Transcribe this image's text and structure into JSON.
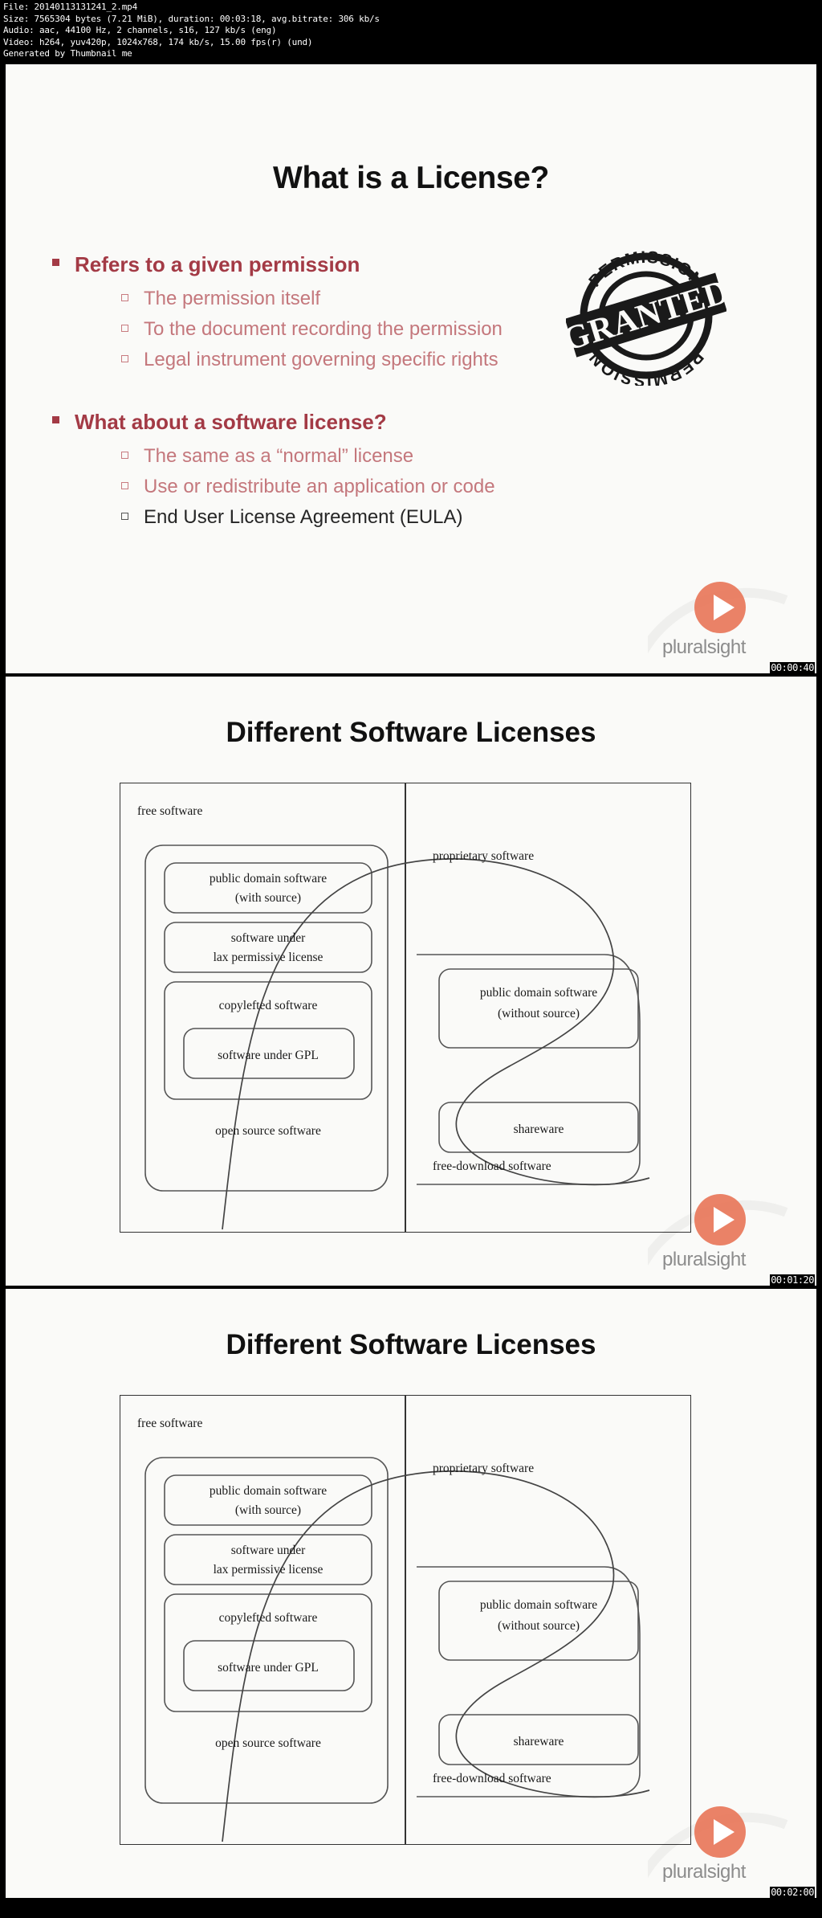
{
  "header": {
    "lines": [
      "File: 20140113131241_2.mp4",
      "Size: 7565304 bytes (7.21 MiB), duration: 00:03:18, avg.bitrate: 306 kb/s",
      "Audio: aac, 44100 Hz, 2 channels, s16, 127 kb/s (eng)",
      "Video: h264, yuv420p, 1024x768, 174 kb/s, 15.00 fps(r) (und)",
      "Generated by Thumbnail me"
    ]
  },
  "brand": {
    "wordmark": "pluralsight",
    "accent_color": "#e8775a"
  },
  "frames": [
    {
      "timestamp": "00:00:40"
    },
    {
      "timestamp": "00:01:20"
    },
    {
      "timestamp": "00:02:00"
    }
  ],
  "slide1": {
    "title": "What is a License?",
    "groups": [
      {
        "heading": "Refers to a given permission",
        "items": [
          {
            "text": "The permission itself",
            "style": "red"
          },
          {
            "text": "To the document recording the permission",
            "style": "red"
          },
          {
            "text": "Legal instrument governing specific rights",
            "style": "red"
          }
        ]
      },
      {
        "heading": "What about a software license?",
        "items": [
          {
            "text": "The same as a “normal” license",
            "style": "red"
          },
          {
            "text": "Use or redistribute an application or code",
            "style": "red"
          },
          {
            "text": "End User License Agreement (EULA)",
            "style": "dark"
          }
        ]
      }
    ],
    "stamp": {
      "arc_top_text": "PERMISSION",
      "arc_bottom_text": "PERMISSION",
      "banner_text": "GRANTED"
    },
    "heading_color": "#a33a45",
    "item_color": "#c4777c"
  },
  "slide2": {
    "title": "Different Software Licenses",
    "diagram": {
      "free_software": "free software",
      "proprietary_software": "proprietary software",
      "public_domain_with_source": [
        "public domain software",
        "(with source)"
      ],
      "software_under_lax": [
        "software under",
        "lax permissive license"
      ],
      "copylefted_software": "copylefted software",
      "software_under_gpl": "software under GPL",
      "open_source_software": "open source software",
      "public_domain_without_source": [
        "public domain software",
        "(without source)"
      ],
      "shareware": "shareware",
      "free_download_software": "free-download software"
    }
  },
  "slide3": {
    "title": "Different Software Licenses"
  }
}
